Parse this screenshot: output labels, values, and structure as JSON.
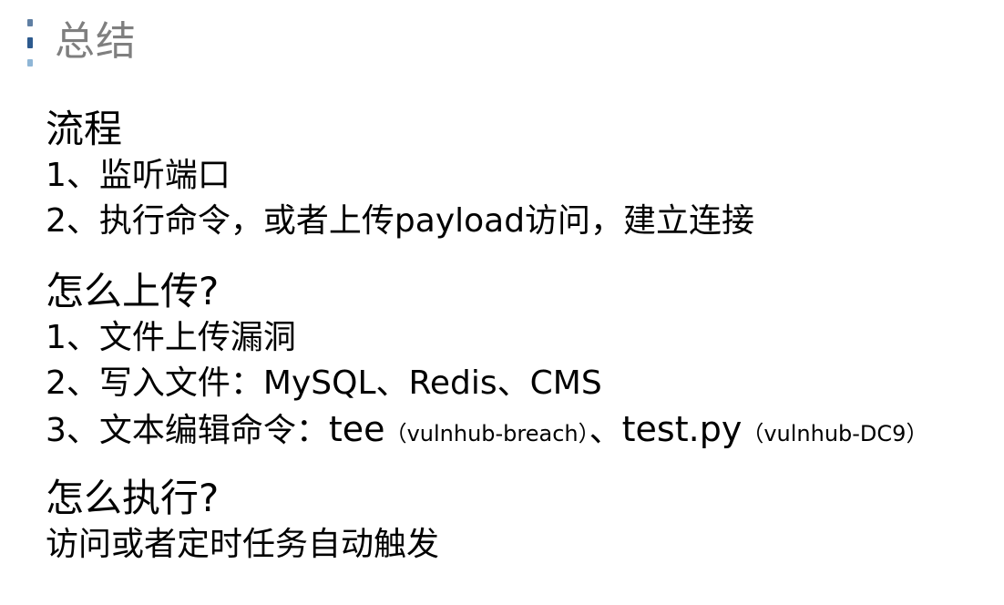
{
  "title": "总结",
  "sections": [
    {
      "heading": "流程",
      "lines": [
        "1、监听端口",
        "2、执行命令，或者上传payload访问，建立连接"
      ]
    },
    {
      "heading": "怎么上传?",
      "lines": [
        "1、文件上传漏洞",
        "2、写入文件：MySQL、Redis、CMS"
      ],
      "line3": {
        "prefix": "3、文本编辑命令：",
        "cmd1": "tee",
        "note1": "（vulnhub-breach）",
        "sep": "、",
        "cmd2": "test.py",
        "note2": "（vulnhub-DC9）"
      }
    },
    {
      "heading": "怎么执行?",
      "lines": [
        "访问或者定时任务自动触发"
      ]
    }
  ],
  "colors": {
    "title": "#7f7f7f",
    "bullet_top": "#5f7fa3",
    "bullet_mid": "#2d5a8e",
    "bullet_bottom": "#8fb6d6"
  }
}
